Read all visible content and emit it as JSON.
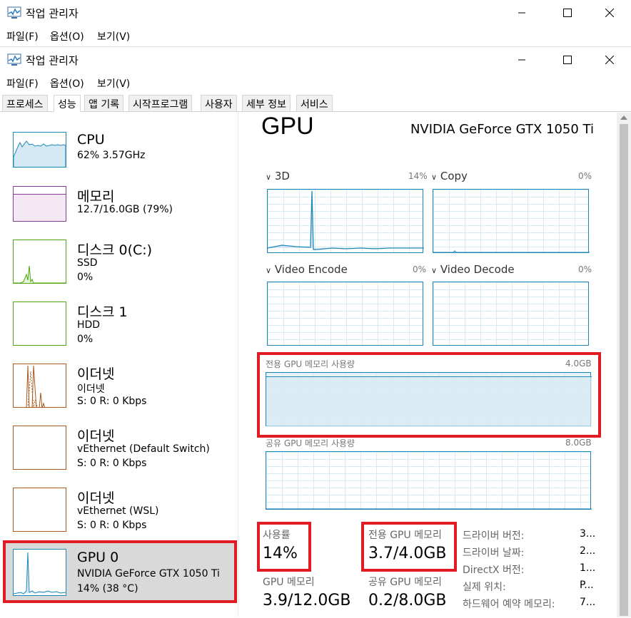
{
  "window_back": {
    "title": "작업 관리자",
    "menu": [
      "파일(F)",
      "옵션(O)",
      "보기(V)"
    ]
  },
  "window": {
    "title": "작업 관리자",
    "menu": [
      "파일(F)",
      "옵션(O)",
      "보기(V)"
    ]
  },
  "tabs": [
    "프로세스",
    "성능",
    "앱 기록",
    "시작프로그램",
    "사용자",
    "세부 정보",
    "서비스"
  ],
  "active_tab": "성능",
  "sidebar": [
    {
      "name": "CPU",
      "line1": "62% 3.57GHz",
      "line2": ""
    },
    {
      "name": "메모리",
      "line1": "12.7/16.0GB (79%)",
      "line2": ""
    },
    {
      "name": "디스크 0(C:)",
      "line1": "SSD",
      "line2": "0%"
    },
    {
      "name": "디스크 1",
      "line1": "HDD",
      "line2": "0%"
    },
    {
      "name": "이더넷",
      "line1": "이더넷",
      "line2": "S: 0 R: 0 Kbps"
    },
    {
      "name": "이더넷",
      "line1": "vEthernet (Default Switch)",
      "line2": "S: 0 R: 0 Kbps"
    },
    {
      "name": "이더넷",
      "line1": "vEthernet (WSL)",
      "line2": "S: 0 R: 0 Kbps"
    },
    {
      "name": "GPU 0",
      "line1": "NVIDIA GeForce GTX 1050 Ti",
      "line2": "14% (38 °C)"
    }
  ],
  "main": {
    "heading": "GPU",
    "model": "NVIDIA GeForce GTX 1050 Ti",
    "engines": [
      {
        "label": "3D",
        "pct": "14%"
      },
      {
        "label": "Copy",
        "pct": "0%"
      },
      {
        "label": "Video Encode",
        "pct": "0%"
      },
      {
        "label": "Video Decode",
        "pct": "0%"
      }
    ],
    "dedicated_graph": {
      "label": "전용 GPU 메모리 사용량",
      "max": "4.0GB"
    },
    "shared_graph": {
      "label": "공유 GPU 메모리 사용량",
      "max": "8.0GB"
    },
    "stats": {
      "usage_label": "사용률",
      "usage_value": "14%",
      "dedicated_label": "전용 GPU 메모리",
      "dedicated_value": "3.7/4.0GB",
      "gpu_mem_label": "GPU 메모리",
      "gpu_mem_value": "3.9/12.0GB",
      "shared_label": "공유 GPU 메모리",
      "shared_value": "0.2/8.0GB"
    },
    "info": [
      {
        "label": "드라이버 버전:",
        "value": "3..."
      },
      {
        "label": "드라이버 날짜:",
        "value": "2..."
      },
      {
        "label": "DirectX 버전:",
        "value": "1..."
      },
      {
        "label": "실제 위치:",
        "value": "P..."
      },
      {
        "label": "하드웨어 예약 메모리:",
        "value": "7..."
      }
    ]
  },
  "colors": {
    "cpu": "#1f87b8",
    "memory": "#8b3a9b",
    "disk": "#4da60c",
    "ethernet": "#a7581e",
    "gpu": "#1f87b8",
    "highlight": "#e01b24"
  }
}
